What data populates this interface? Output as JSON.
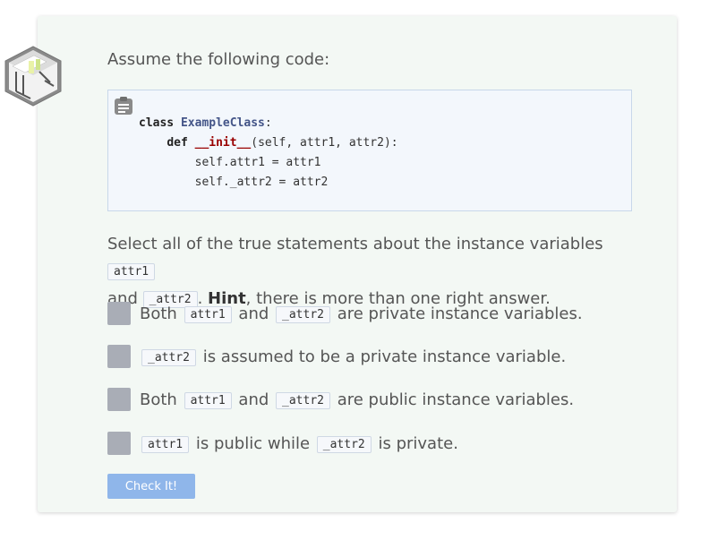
{
  "intro": "Assume the following code:",
  "code": {
    "line1_kw": "class",
    "line1_name": "ExampleClass",
    "line1_end": ":",
    "line2_kw": "def",
    "line2_name": "__init__",
    "line2_end": "(self, attr1, attr2):",
    "line3": "self.attr1 = attr1",
    "line4": "self._attr2 = attr2",
    "copy_icon": "clipboard-icon"
  },
  "prompt": {
    "text1": "Select all of the true statements about the instance variables ",
    "code1": "attr1",
    "text2": " and ",
    "code2": "_attr2",
    "text3": ". ",
    "hint": "Hint",
    "text4": ", there is more than one right answer."
  },
  "options": [
    {
      "pre": "Both ",
      "c1": "attr1",
      "mid": " and ",
      "c2": "_attr2",
      "post": " are private instance variables."
    },
    {
      "c1": "_attr2",
      "post": " is assumed to be a private instance variable."
    },
    {
      "pre": "Both ",
      "c1": "attr1",
      "mid": " and ",
      "c2": "_attr2",
      "post": " are public instance variables."
    },
    {
      "c1": "attr1",
      "mid": " is public while ",
      "c2": "_attr2",
      "post": " is private."
    }
  ],
  "check_button": "Check It!",
  "colors": {
    "card_bg": "#f3f8f4",
    "code_bg": "#f3f7fc",
    "checkbox": "#a9adb6",
    "button": "#8fb6ea"
  },
  "logo_icon": "isometric-room-logo"
}
